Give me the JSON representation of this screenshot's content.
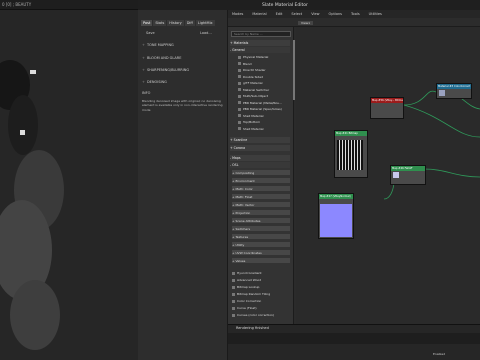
{
  "render_window": {
    "title": "0 [0] ; BEAUTY"
  },
  "side_panel": {
    "tabs": [
      "Post",
      "Stats",
      "History",
      "Diff",
      "LightMix"
    ],
    "row_buttons": [
      "Save",
      "Load..."
    ],
    "sections": [
      "TONE MAPPING",
      "BLOOM AND GLARE",
      "SHARPENING/BLURRING",
      "DENOISING"
    ],
    "info_heading": "INFO",
    "info_text": "Blending denoised image with original; no denoising element is available only in non-interactive rendering mode"
  },
  "slate": {
    "title": "Slate Material Editor",
    "menus": [
      "Modes",
      "Material",
      "Edit",
      "Select",
      "View",
      "Options",
      "Tools",
      "Utilities"
    ],
    "view_tab": "View1",
    "search_placeholder": "Search by Name ...",
    "browser": {
      "materials_label": "+ Materials",
      "general_label": "- General",
      "general_items": [
        "Physical Material",
        "Blend",
        "DirectX Shader",
        "Double Sided",
        "glTF Material",
        "Material Switcher",
        "Multi/Sub-Object",
        "PBR Material (Metal/Rou...",
        "PBR Material (Spec/Gloss)",
        "Shell Material",
        "Top/Bottom",
        "Shell Material"
      ],
      "scanline_label": "+ Scanline",
      "corona_label": "+ Corona",
      "maps_label": "- Maps",
      "osl_label": "- OSL",
      "osl_groups": [
        "+ Compositing",
        "+ Environment",
        "+ Math: Color",
        "+ Math: Float",
        "+ Math: Vector",
        "+ Projection",
        "+ Scene Attributes",
        "+ Switchers",
        "+ Textures",
        "+ Utility",
        "+ UVW Coordinates",
        "+ Values"
      ],
      "map_items": [
        "Hyundi Gradient",
        "Advanced Wood",
        "Bitmap Lookup",
        "Bitmap Random Tiling",
        "Color Correction",
        "Curve (Float)",
        "Curves (color correction)"
      ]
    },
    "nodes": [
      {
        "title": "Map #56 (VRay... Bitmap)",
        "color": "#9b1b1b"
      },
      {
        "title": "Material #3 ColorCorrect",
        "color": "#1f6b8f"
      },
      {
        "title": "Map #41 Bitmap",
        "color": "#2f8f4e"
      },
      {
        "title": "Map #46 Falloff",
        "color": "#2f8f4e"
      },
      {
        "title": "Map #47 (VRayNormal)",
        "color": "#2f8f4e"
      }
    ],
    "status": "Rendering finished",
    "zoom": "Enabled"
  }
}
